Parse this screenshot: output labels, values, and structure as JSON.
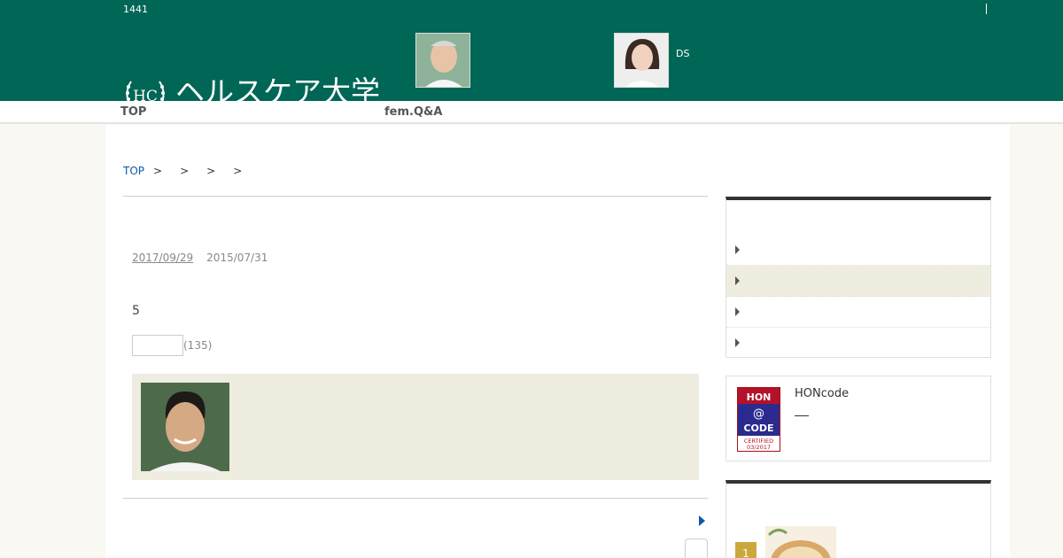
{
  "header": {
    "counter": "1441",
    "logo_mark": "HC",
    "logo_text": "ヘルスケア大学",
    "ds_label": "DS"
  },
  "nav": {
    "items": [
      {
        "label": "TOP"
      },
      {
        "label": "fem.Q&A"
      }
    ]
  },
  "breadcrumb": {
    "home": "TOP",
    "separators": [
      ">",
      ">",
      ">",
      ">"
    ]
  },
  "article": {
    "updated_date": "2017/09/29",
    "published_date": "2015/07/31",
    "number": "5",
    "rating_count": "(135)"
  },
  "sidebar": {
    "menu_rows": 4,
    "highlighted_row": 1,
    "hon": {
      "title": "HONcode",
      "badge_line1": "HON",
      "badge_line2": "@",
      "badge_line3": "CODE",
      "badge_certified": "CERTIFIED",
      "badge_date": "03/2017"
    },
    "ranking": {
      "first_rank": "1"
    }
  },
  "colors": {
    "header_green": "#006656",
    "link_blue": "#0d5ba3",
    "author_box_bg": "#eeede0",
    "rank_gold": "#c9a93e"
  },
  "icons": [
    "caret-right-icon",
    "next-arrow-icon",
    "laurel-logo-icon"
  ]
}
